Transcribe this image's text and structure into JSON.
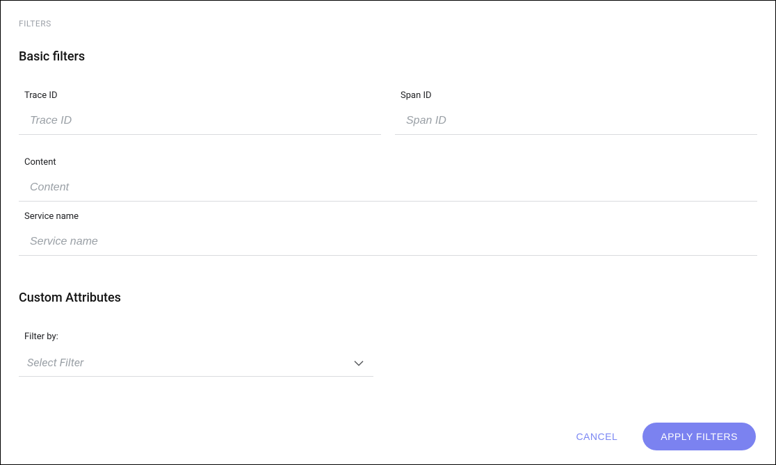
{
  "header": {
    "title": "FILTERS"
  },
  "sections": {
    "basic": {
      "title": "Basic filters",
      "trace_id": {
        "label": "Trace ID",
        "placeholder": "Trace ID",
        "value": ""
      },
      "span_id": {
        "label": "Span ID",
        "placeholder": "Span ID",
        "value": ""
      },
      "content": {
        "label": "Content",
        "placeholder": "Content",
        "value": ""
      },
      "service_name": {
        "label": "Service name",
        "placeholder": "Service name",
        "value": ""
      }
    },
    "custom": {
      "title": "Custom Attributes",
      "filter_by": {
        "label": "Filter by:",
        "placeholder": "Select Filter",
        "value": ""
      }
    }
  },
  "footer": {
    "cancel_label": "CANCEL",
    "apply_label": "APPLY FILTERS"
  }
}
